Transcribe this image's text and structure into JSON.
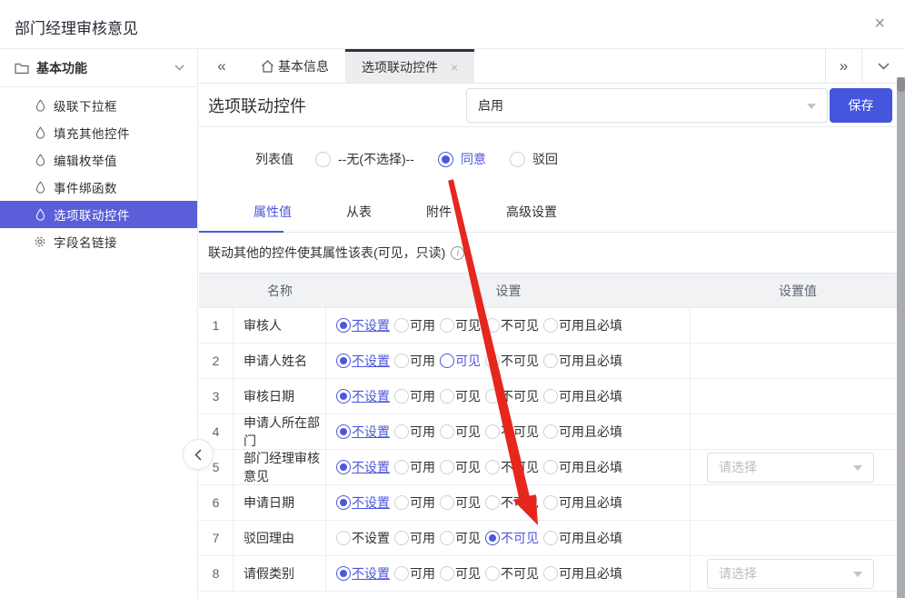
{
  "window": {
    "title": "部门经理审核意见",
    "close_label": "×"
  },
  "sidebar": {
    "group_label": "基本功能",
    "items": [
      {
        "label": "级联下拉框",
        "icon": "droplet-icon",
        "selected": false
      },
      {
        "label": "填充其他控件",
        "icon": "droplet-icon",
        "selected": false
      },
      {
        "label": "编辑枚举值",
        "icon": "droplet-icon",
        "selected": false
      },
      {
        "label": "事件绑函数",
        "icon": "droplet-icon",
        "selected": false
      },
      {
        "label": "选项联动控件",
        "icon": "droplet-icon",
        "selected": true
      },
      {
        "label": "字段名链接",
        "icon": "gear-icon",
        "selected": false
      }
    ]
  },
  "tabbar": {
    "collapse_label": "«",
    "overflow_label": "»",
    "tabs": [
      {
        "label": "基本信息",
        "icon": "home-icon",
        "active": false,
        "closable": false
      },
      {
        "label": "选项联动控件",
        "icon": null,
        "active": true,
        "closable": true,
        "close_label": "×"
      }
    ]
  },
  "panel": {
    "title": "选项联动控件",
    "status_select_value": "启用",
    "save_label": "保存",
    "list_value": {
      "label": "列表值",
      "options": [
        {
          "label": "--无(不选择)--",
          "selected": false
        },
        {
          "label": "同意",
          "selected": true
        },
        {
          "label": "驳回",
          "selected": false
        }
      ]
    },
    "tabs": [
      {
        "label": "属性值",
        "active": true
      },
      {
        "label": "从表",
        "active": false
      },
      {
        "label": "附件",
        "active": false
      },
      {
        "label": "高级设置",
        "active": false
      }
    ],
    "hint": "联动其他的控件使其属性该表(可见，只读)",
    "info_icon": "i"
  },
  "table": {
    "headers": [
      "",
      "名称",
      "设置",
      "设置值"
    ],
    "option_labels": [
      "不设置",
      "可用",
      "可见",
      "不可见",
      "可用且必填"
    ],
    "rows": [
      {
        "index": 1,
        "name": "审核人",
        "selected": 0,
        "focused": null,
        "value_select": null
      },
      {
        "index": 2,
        "name": "申请人姓名",
        "selected": 0,
        "focused": 2,
        "value_select": null
      },
      {
        "index": 3,
        "name": "审核日期",
        "selected": 0,
        "focused": null,
        "value_select": null
      },
      {
        "index": 4,
        "name": "申请人所在部门",
        "selected": 0,
        "focused": null,
        "value_select": null
      },
      {
        "index": 5,
        "name": "部门经理审核意见",
        "selected": 0,
        "focused": null,
        "value_select": "请选择"
      },
      {
        "index": 6,
        "name": "申请日期",
        "selected": 0,
        "focused": null,
        "value_select": null
      },
      {
        "index": 7,
        "name": "驳回理由",
        "selected": 3,
        "focused": null,
        "value_select": null
      },
      {
        "index": 8,
        "name": "请假类别",
        "selected": 0,
        "focused": null,
        "value_select": "请选择"
      }
    ]
  },
  "colors": {
    "accent": "#4d57d9",
    "sidebar_selected": "#5a5ed8",
    "save_button": "#4456dd",
    "arrow": "#e5271d",
    "active_tab_top": "#2e3442"
  }
}
